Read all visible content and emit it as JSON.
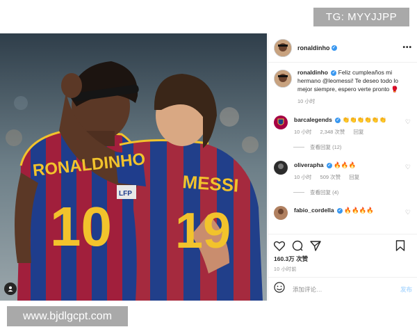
{
  "watermarks": {
    "tg": "TG: MYYJJPP",
    "url": "www.bjdlgcpt.com"
  },
  "photo": {
    "jersey_left_name": "RONALDINHO",
    "jersey_left_number": "10",
    "jersey_right_name": "MESSI",
    "jersey_right_number": "19",
    "sponsor": "LFP",
    "user_tag_icon": "person-icon"
  },
  "header": {
    "username": "ronaldinho",
    "more_icon": "more-options-icon"
  },
  "caption": {
    "username": "ronaldinho",
    "text": "Feliz cumpleaños mi hermano @leomessi! Te deseo todo lo mejor siempre, espero verte pronto 🥊",
    "time": "10 小时"
  },
  "comments": [
    {
      "username": "barcalegends",
      "text": "👏👏👏👏👏👏",
      "time": "10 小时",
      "likes": "2,348 次赞",
      "reply": "回复",
      "view_replies": "查看回复 (12)",
      "avatar_color": "#a50044"
    },
    {
      "username": "oliverapha",
      "text": "🔥🔥🔥",
      "time": "10 小时",
      "likes": "509 次赞",
      "reply": "回复",
      "view_replies": "查看回复 (4)",
      "avatar_color": "#333333"
    },
    {
      "username": "fabio_cordella",
      "text": "🔥🔥🔥🔥",
      "avatar_color": "#b08060"
    }
  ],
  "actions": {
    "likes": "160.3万 次赞",
    "time": "10 小时前"
  },
  "add_comment": {
    "placeholder": "添加评论…",
    "post_label": "发布"
  },
  "colors": {
    "verified": "#3897f0",
    "barca_blue": "#1e3f8a",
    "barca_red": "#a3213b",
    "number_yellow": "#f2c32c"
  }
}
